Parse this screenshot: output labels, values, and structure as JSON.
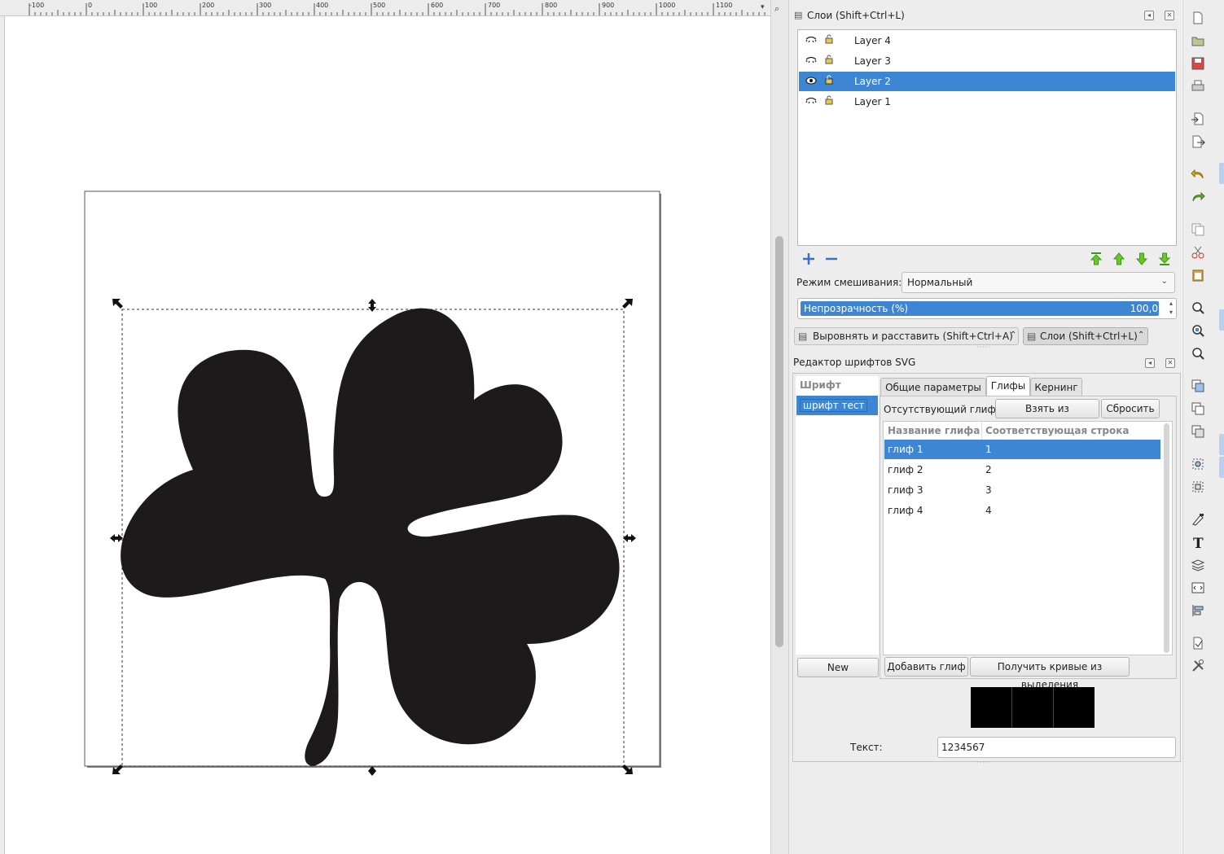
{
  "ruler": {
    "labels": [
      "-100",
      "0",
      "100",
      "200",
      "300",
      "400",
      "500",
      "600",
      "700",
      "800",
      "900",
      "1000",
      "1100"
    ]
  },
  "layers_panel": {
    "title": "Слои (Shift+Ctrl+L)",
    "layers": [
      {
        "name": "Layer 4",
        "selected": false
      },
      {
        "name": "Layer 3",
        "selected": false
      },
      {
        "name": "Layer 2",
        "selected": true
      },
      {
        "name": "Layer 1",
        "selected": false
      }
    ],
    "blend_mode_label": "Режим смешивания:",
    "blend_mode_value": "Нормальный",
    "opacity_label": "Непрозрачность (%)",
    "opacity_value": "100,0",
    "opacity_fraction": 1.0
  },
  "dock_tabs": {
    "align": "Выровнять и расставить (Shift+Ctrl+A)",
    "layers": "Слои (Shift+Ctrl+L)"
  },
  "font_editor": {
    "title": "Редактор шрифтов SVG",
    "font_header": "Шрифт",
    "font_item": "шрифт тест",
    "new_button": "New",
    "tabs": [
      "Общие параметры",
      "Глифы",
      "Кернинг"
    ],
    "active_tab": "Глифы",
    "missing_glyph_label": "Отсутствующий глиф:",
    "from_selection_button": "Взять из выделения",
    "reset_button": "Сбросить",
    "col_glyph_name": "Название глифа",
    "col_matching_string": "Соответствующая строка",
    "glyphs": [
      {
        "name": "глиф 1",
        "string": "1",
        "selected": true
      },
      {
        "name": "глиф 2",
        "string": "2",
        "selected": false
      },
      {
        "name": "глиф 3",
        "string": "3",
        "selected": false
      },
      {
        "name": "глиф 4",
        "string": "4",
        "selected": false
      }
    ],
    "add_glyph_button": "Добавить глиф",
    "get_curves_button": "Получить кривые из выделения",
    "text_label": "Текст:",
    "text_value": "1234567"
  },
  "colors": {
    "selection": "#3d86d4",
    "shape": "#1c1a1b",
    "arrow_green": "#4caf1f"
  }
}
